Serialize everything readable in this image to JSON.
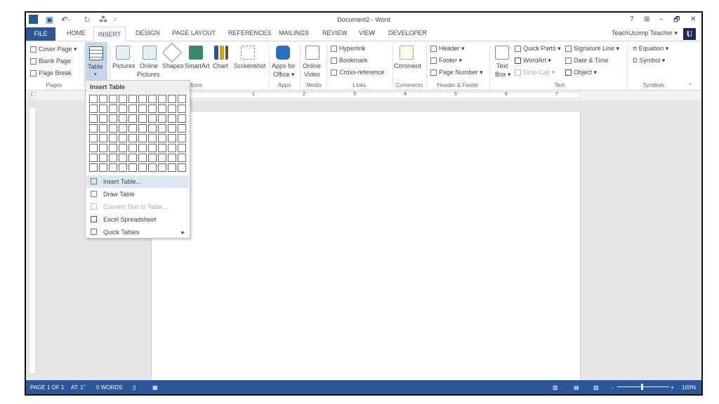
{
  "window": {
    "title": "Document2 - Word",
    "help": "?",
    "ribbon_display": "⊞",
    "minimize": "–",
    "restore": "🗗",
    "close": "✕",
    "user": "TeachUcomp Teacher ▾",
    "avatar_letter": "U",
    "qat": {
      "undo": "↶·",
      "redo": "↻",
      "touch": "⁂",
      "customize": "="
    }
  },
  "tabs": [
    "FILE",
    "HOME",
    "INSERT",
    "DESIGN",
    "PAGE LAYOUT",
    "REFERENCES",
    "MAILINGS",
    "REVIEW",
    "VIEW",
    "DEVELOPER"
  ],
  "ribbon": {
    "pages": {
      "items": [
        "Cover Page ▾",
        "Blank Page",
        "Page Break"
      ],
      "label": "Pages"
    },
    "tables": {
      "table": "Table",
      "arrow": "▾"
    },
    "illustrations": {
      "items": [
        "Pictures",
        "Online",
        "Shapes",
        "SmartArt",
        "Chart",
        "Screenshot"
      ],
      "online2": "Pictures",
      "label": "ations"
    },
    "apps": {
      "b1": "Apps for",
      "b2": "Office ▾",
      "label": "Apps"
    },
    "media": {
      "b1": "Online",
      "b2": "Video",
      "label": "Media"
    },
    "links": {
      "items": [
        "Hyperlink",
        "Bookmark",
        "Cross-reference"
      ],
      "label": "Links"
    },
    "comments": {
      "item": "Comment",
      "label": "Comments"
    },
    "header_footer": {
      "items": [
        "Header ▾",
        "Footer ▾",
        "Page Number ▾"
      ],
      "label": "Header & Footer"
    },
    "text": {
      "textbox1": "Text",
      "textbox2": "Box ▾",
      "col1": [
        "Quick Parts ▾",
        "WordArt ▾",
        "Drop Cap ▾"
      ],
      "col2": [
        "Signature Line ▾",
        "Date & Time",
        "Object ▾"
      ],
      "label": "Text"
    },
    "symbols": {
      "items": [
        "π Equation ▾",
        "Ω Symbol ▾"
      ],
      "label": "Symbols",
      "collapse": "^"
    }
  },
  "menu": {
    "header": "Insert Table",
    "grid_cols": 10,
    "grid_rows": 8,
    "items": [
      "Insert Table...",
      "Draw Table",
      "Convert Text to Table...",
      "Excel Spreadsheet",
      "Quick Tables"
    ],
    "submenu_arrow": "▸"
  },
  "ruler": {
    "marks": [
      "1",
      "2",
      "3",
      "4",
      "5",
      "6",
      "7"
    ],
    "corner": "L"
  },
  "status": {
    "page": "PAGE 1 OF 1",
    "at": "AT: 1\"",
    "words": "0 WORDS",
    "zoom": "100%",
    "zoom_minus": "-",
    "zoom_plus": "+"
  }
}
